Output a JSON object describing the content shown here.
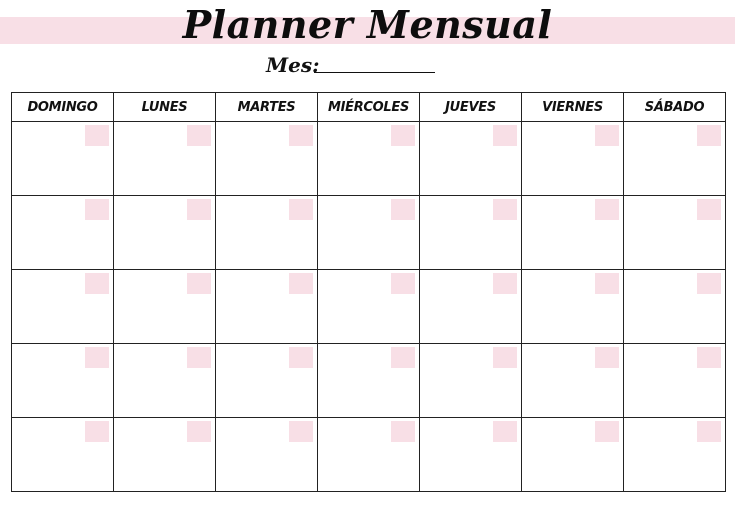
{
  "title": "Planner Mensual",
  "month_label": "Mes:",
  "accent_color": "#f8dfe6",
  "weekdays": [
    "DOMINGO",
    "LUNES",
    "MARTES",
    "MIÉRCOLES",
    "JUEVES",
    "VIERNES",
    "SÁBADO"
  ],
  "weeks": 5
}
